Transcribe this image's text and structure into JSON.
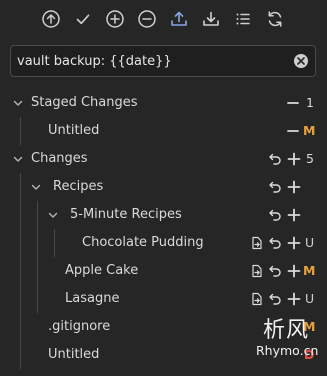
{
  "toolbar": {
    "buttons": [
      {
        "name": "commit-button",
        "icon": "circle-arrow-up-icon"
      },
      {
        "name": "check-button",
        "icon": "check-icon"
      },
      {
        "name": "stage-all-button",
        "icon": "circle-plus-icon"
      },
      {
        "name": "unstage-all-button",
        "icon": "circle-minus-icon"
      },
      {
        "name": "push-button",
        "icon": "upload-icon"
      },
      {
        "name": "pull-button",
        "icon": "download-icon"
      },
      {
        "name": "list-view-button",
        "icon": "list-icon"
      },
      {
        "name": "refresh-button",
        "icon": "refresh-icon"
      }
    ],
    "active_color": "#8aa4e6"
  },
  "commit": {
    "message": "vault backup: {{date}}"
  },
  "staged": {
    "title": "Staged Changes",
    "count": "1",
    "items": [
      {
        "name": "Untitled",
        "status": "M"
      }
    ]
  },
  "changes": {
    "title": "Changes",
    "count": "5",
    "folders": [
      {
        "name": "Recipes"
      },
      {
        "name": "5-Minute Recipes"
      }
    ],
    "files": [
      {
        "name": "Chocolate Pudding",
        "status": "U"
      },
      {
        "name": "Apple Cake",
        "status": "M"
      },
      {
        "name": "Lasagne",
        "status": "U"
      },
      {
        "name": ".gitignore",
        "status": "M"
      },
      {
        "name": "Untitled",
        "status": "D"
      }
    ]
  },
  "colors": {
    "modified": "#e9a23b",
    "untracked": "#cfcfcf",
    "deleted": "#e5534b",
    "accent": "#8aa4e6"
  },
  "watermark": {
    "line1": "析风",
    "line2": "Rhymo.cn"
  }
}
